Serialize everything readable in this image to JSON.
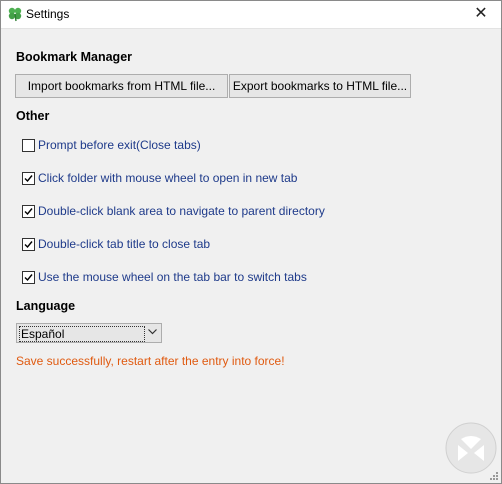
{
  "window": {
    "title": "Settings",
    "close_label": "✕"
  },
  "bookmark_manager": {
    "heading": "Bookmark Manager",
    "import_label": "Import bookmarks from HTML file...",
    "export_label": "Export bookmarks to HTML file..."
  },
  "other": {
    "heading": "Other",
    "options": [
      {
        "label": "Prompt before exit(Close tabs)",
        "checked": false
      },
      {
        "label": "Click folder with mouse wheel to open in new tab",
        "checked": true
      },
      {
        "label": "Double-click blank area to navigate to parent directory",
        "checked": true
      },
      {
        "label": "Double-click tab title to close tab",
        "checked": true
      },
      {
        "label": "Use the mouse wheel on the tab bar to switch tabs",
        "checked": true
      }
    ]
  },
  "language": {
    "heading": "Language",
    "selected": "Español"
  },
  "status": {
    "message": "Save successfully, restart after the entry into force!",
    "color": "#e05a10"
  },
  "colors": {
    "accent_label": "#1e3a8a",
    "window_bg": "#f0f0f0"
  }
}
